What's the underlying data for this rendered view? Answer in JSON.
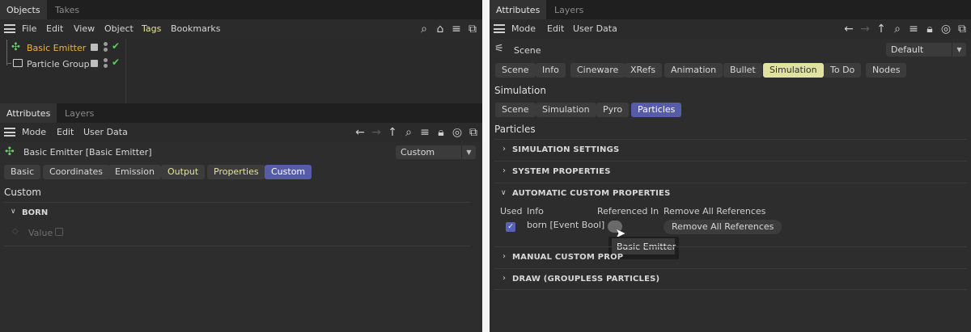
{
  "left": {
    "objects_tabs": [
      "Objects",
      "Takes"
    ],
    "objects_menu": [
      "File",
      "Edit",
      "View",
      "Object",
      "Tags",
      "Bookmarks"
    ],
    "tree": [
      {
        "label": "Basic Emitter",
        "selected": true
      },
      {
        "label": "Particle Group",
        "selected": false
      }
    ],
    "attr_tabs": [
      "Attributes",
      "Layers"
    ],
    "attr_menu": [
      "Mode",
      "Edit",
      "User Data"
    ],
    "object_title": "Basic Emitter [Basic Emitter]",
    "mode_dropdown": "Custom",
    "buttons": [
      {
        "label": "Basic"
      },
      {
        "label": "Coordinates"
      },
      {
        "label": "Emission"
      },
      {
        "label": "Output"
      },
      {
        "label": "Properties"
      },
      {
        "label": "Custom"
      }
    ],
    "section_heading": "Custom",
    "group_label": "BORN",
    "value_label": "Value"
  },
  "right": {
    "tabs": [
      "Attributes",
      "Layers"
    ],
    "menu": [
      "Mode",
      "Edit",
      "User Data"
    ],
    "scene_label": "Scene",
    "scene_dropdown": "Default",
    "row1": [
      {
        "label": "Scene"
      },
      {
        "label": "Info"
      },
      {
        "label": "Cineware"
      },
      {
        "label": "XRefs"
      },
      {
        "label": "Animation"
      },
      {
        "label": "Bullet"
      },
      {
        "label": "Simulation"
      },
      {
        "label": "To Do"
      },
      {
        "label": "Nodes"
      }
    ],
    "simulation_heading": "Simulation",
    "row2": [
      {
        "label": "Scene"
      },
      {
        "label": "Simulation"
      },
      {
        "label": "Pyro"
      },
      {
        "label": "Particles"
      }
    ],
    "particles_heading": "Particles",
    "sections": {
      "sim_settings": "SIMULATION SETTINGS",
      "sys_props": "SYSTEM PROPERTIES",
      "auto_props": "AUTOMATIC CUSTOM PROPERTIES",
      "manual_props": "MANUAL CUSTOM PROP",
      "draw": "DRAW (GROUPLESS PARTICLES)"
    },
    "table": {
      "headers": [
        "Used",
        "Info",
        "Referenced In",
        "Remove All References"
      ],
      "row_info": "born [Event Bool]",
      "remove_button": "Remove All References"
    },
    "tooltip": "Basic Emitter"
  }
}
